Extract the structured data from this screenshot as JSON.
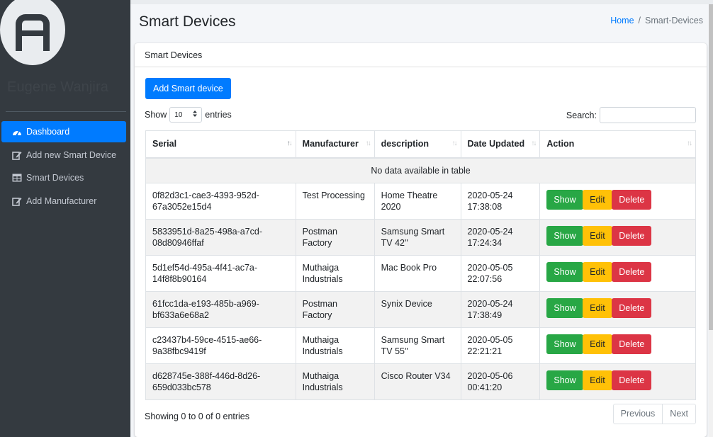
{
  "sidebar": {
    "user_name": "Eugene Wanjira",
    "items": [
      {
        "label": "Dashboard",
        "icon": "dashboard-icon",
        "active": true
      },
      {
        "label": "Add new Smart Device",
        "icon": "edit-icon",
        "active": false
      },
      {
        "label": "Smart Devices",
        "icon": "table-icon",
        "active": false
      },
      {
        "label": "Add Manufacturer",
        "icon": "edit-icon",
        "active": false
      }
    ]
  },
  "header": {
    "title": "Smart Devices",
    "breadcrumb": {
      "home": "Home",
      "separator": "/",
      "current": "Smart-Devices"
    }
  },
  "card": {
    "title": "Smart Devices",
    "add_button": "Add Smart device",
    "show_label": "Show",
    "entries_value": "10",
    "entries_label": "entries",
    "search_label": "Search:",
    "search_value": "",
    "columns": [
      "Serial",
      "Manufacturer",
      "description",
      "Date Updated",
      "Action"
    ],
    "empty_message": "No data available in table",
    "rows": [
      {
        "serial": "0f82d3c1-cae3-4393-952d-67a3052e15d4",
        "manufacturer": "Test Processing",
        "description": "Home Theatre 2020",
        "date": "2020-05-24 17:38:08"
      },
      {
        "serial": "5833951d-8a25-498a-a7cd-08d80946ffaf",
        "manufacturer": "Postman Factory",
        "description": "Samsung Smart TV 42''",
        "date": "2020-05-24 17:24:34"
      },
      {
        "serial": "5d1ef54d-495a-4f41-ac7a-14f8f8b90164",
        "manufacturer": "Muthaiga Industrials",
        "description": "Mac Book Pro",
        "date": "2020-05-05 22:07:56"
      },
      {
        "serial": "61fcc1da-e193-485b-a969-bf633a6e68a2",
        "manufacturer": "Postman Factory",
        "description": "Synix Device",
        "date": "2020-05-24 17:38:49"
      },
      {
        "serial": "c23437b4-59ce-4515-ae66-9a38fbc9419f",
        "manufacturer": "Muthaiga Industrials",
        "description": "Samsung Smart TV 55''",
        "date": "2020-05-05 22:21:21"
      },
      {
        "serial": "d628745e-388f-446d-8d26-659d033bc578",
        "manufacturer": "Muthaiga Industrials",
        "description": "Cisco Router V34",
        "date": "2020-05-06 00:41:20"
      }
    ],
    "action_labels": {
      "show": "Show",
      "edit": "Edit",
      "delete": "Delete"
    },
    "info": "Showing 0 to 0 of 0 entries",
    "pager": {
      "previous": "Previous",
      "next": "Next"
    }
  },
  "colors": {
    "primary": "#007bff",
    "success": "#28a745",
    "warning": "#ffc107",
    "danger": "#dc3545",
    "sidebar_bg": "#343a40"
  }
}
